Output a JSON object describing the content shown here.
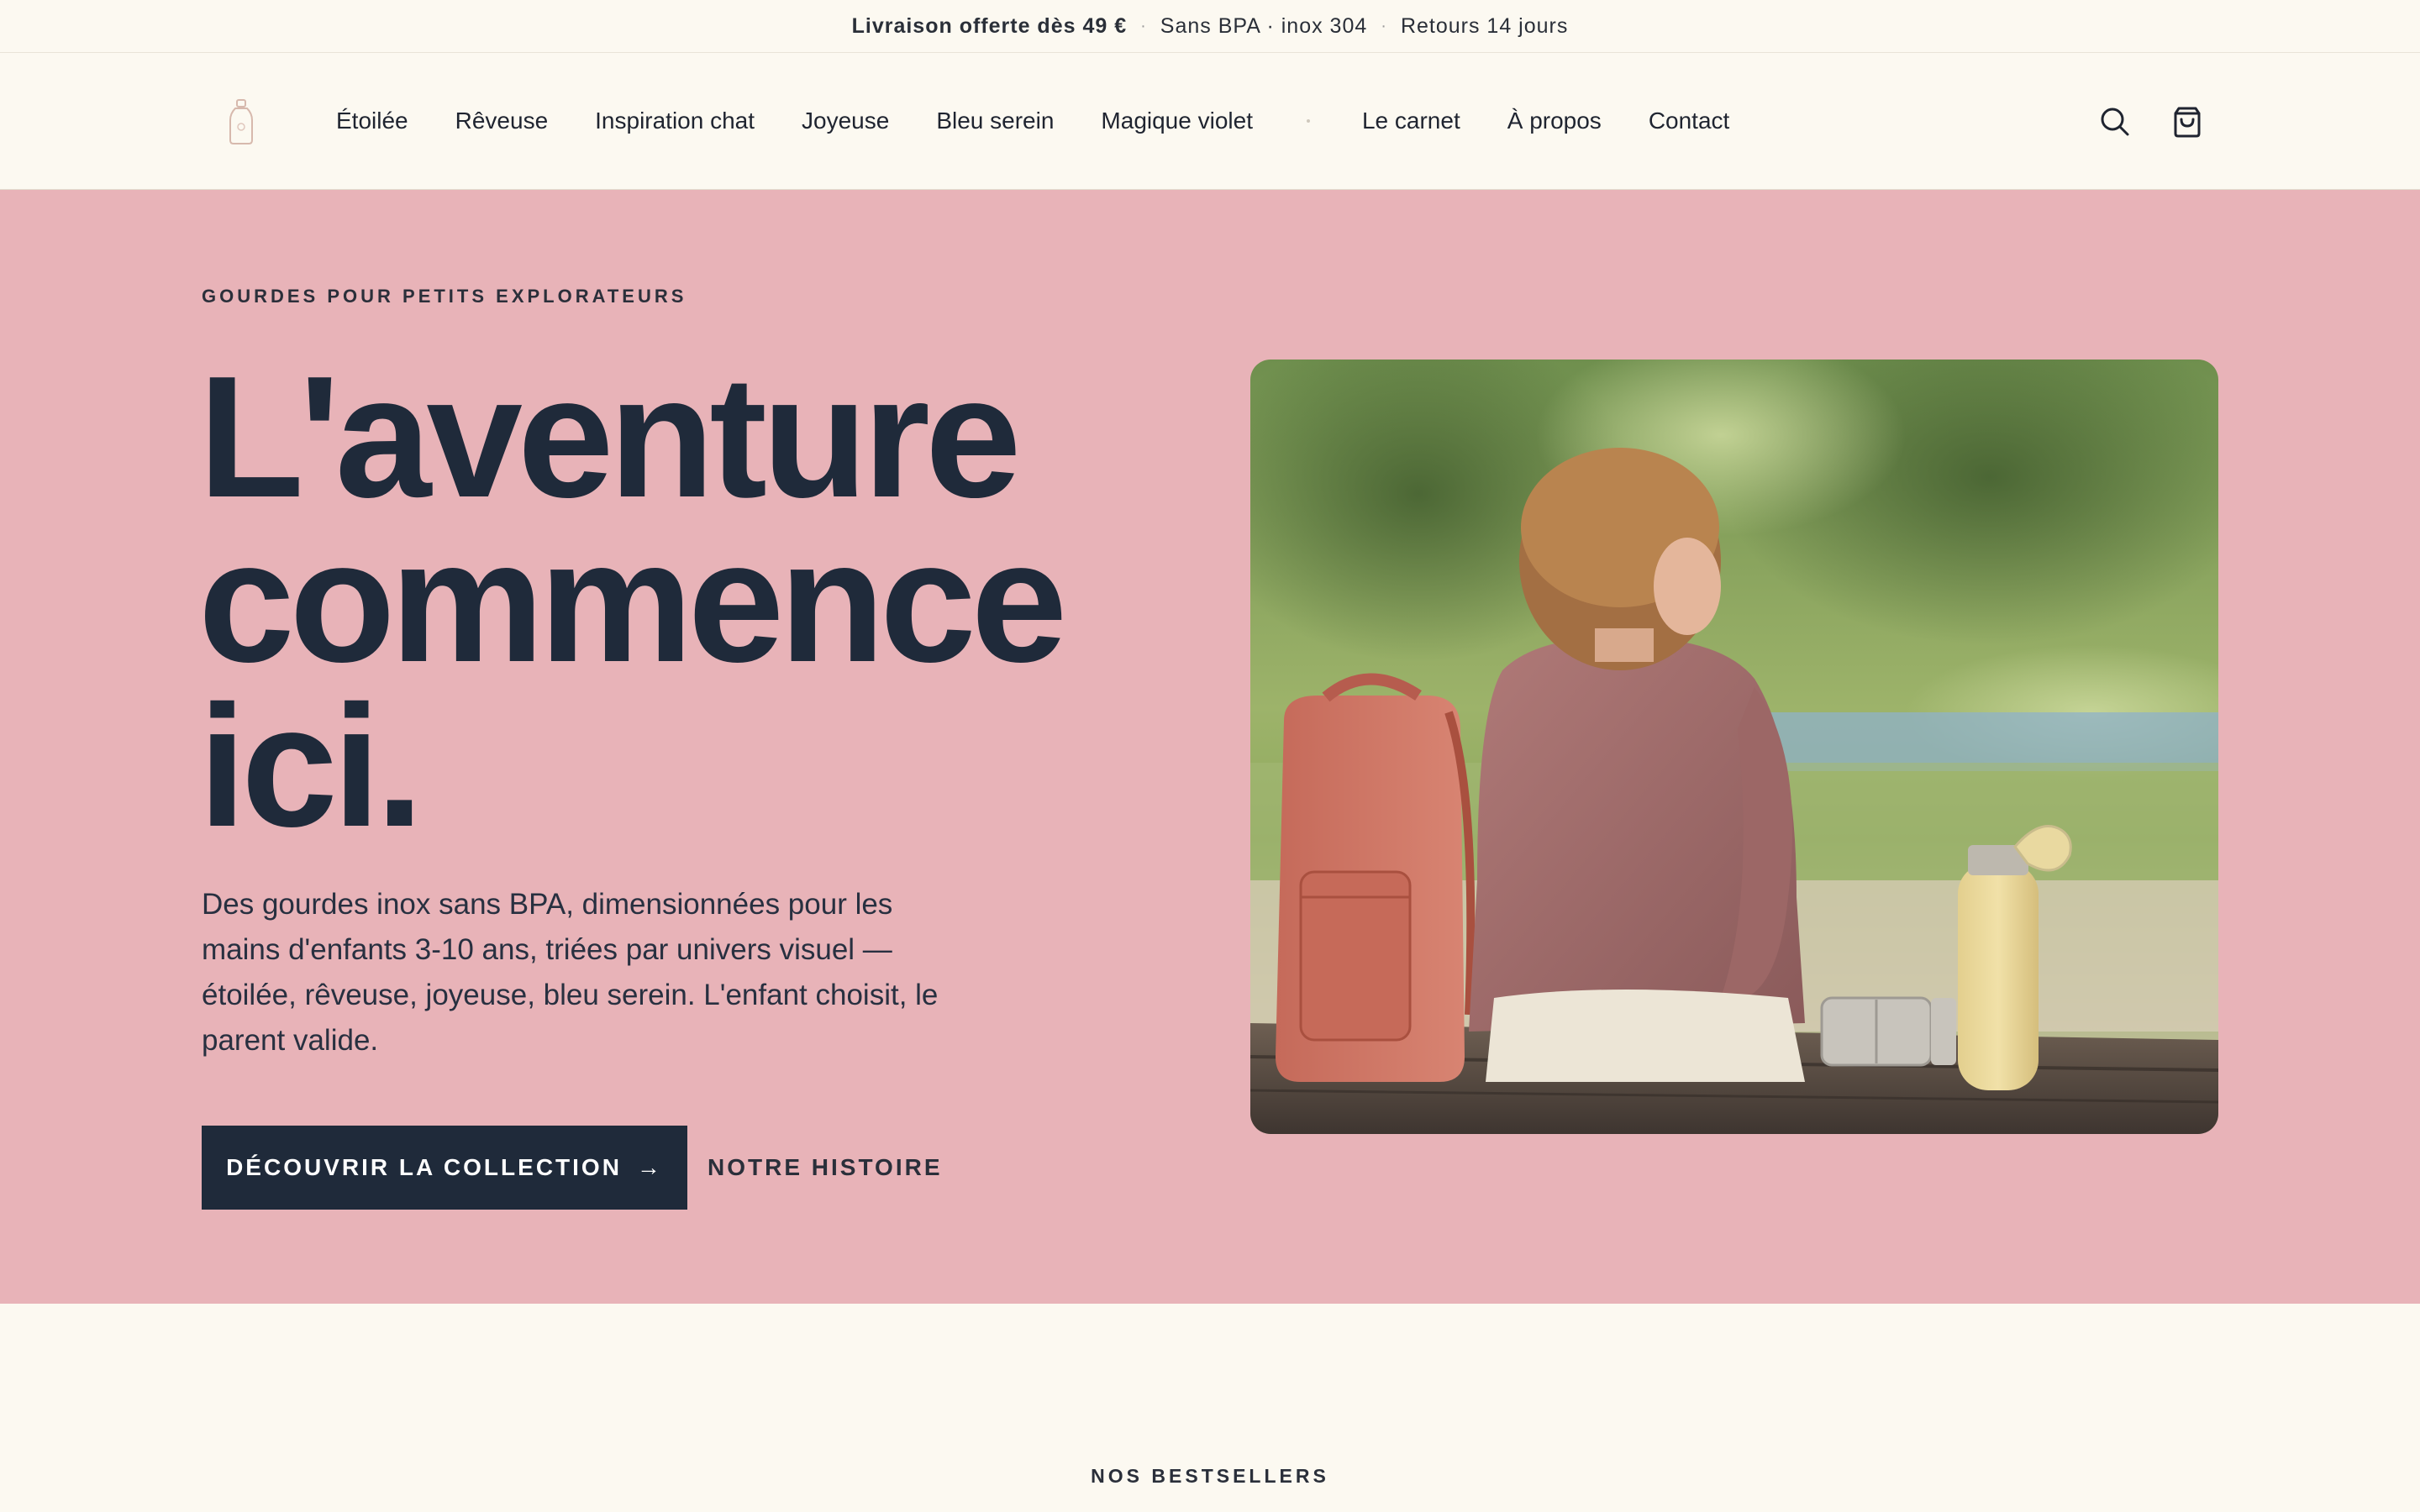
{
  "announcement": {
    "free_shipping": "Livraison offerte dès 49 €",
    "bpa": "Sans BPA · inox 304",
    "returns": "Retours 14 jours"
  },
  "nav": {
    "items": [
      "Étoilée",
      "Rêveuse",
      "Inspiration chat",
      "Joyeuse",
      "Bleu serein",
      "Magique violet"
    ],
    "secondary": [
      "Le carnet",
      "À propos",
      "Contact"
    ]
  },
  "icons": {
    "logo": "bottle-logo-icon",
    "search": "search-icon",
    "cart": "shopping-bag-icon"
  },
  "hero": {
    "eyebrow": "GOURDES POUR PETITS EXPLORATEURS",
    "headline_lines": [
      "L'aventure",
      "commence",
      "ici."
    ],
    "lead": "Des gourdes inox sans BPA, dimensionnées pour les mains d'enfants 3-10 ans, triées par univers visuel — étoilée, rêveuse, joyeuse, bleu serein. L'enfant choisit, le parent valide.",
    "cta_primary": "DÉCOUVRIR LA COLLECTION",
    "cta_arrow": "→",
    "cta_secondary": "NOTRE HISTOIRE"
  },
  "bestsellers": {
    "title": "NOS BESTSELLERS"
  },
  "colors": {
    "background": "#fcf9f1",
    "hero_background": "#e8b3b8",
    "ink": "#1f2a3a"
  }
}
